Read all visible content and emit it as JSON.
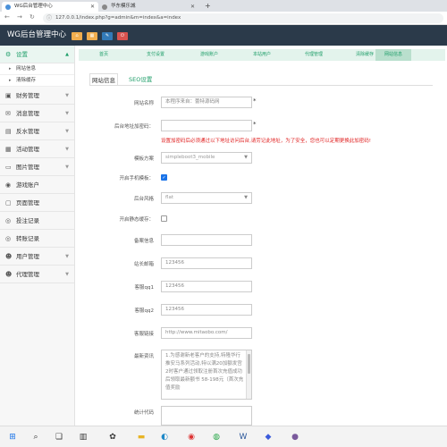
{
  "browser": {
    "tabs": [
      {
        "title": "WG后台管理中心",
        "active": true
      },
      {
        "title": "华东模乐城",
        "active": false
      }
    ],
    "new_tab": "+",
    "url": "127.0.0.1/index.php?g=admin&m=index&a=index"
  },
  "header": {
    "brand": "WG后台管理中心",
    "buttons": [
      {
        "icon": "home-icon",
        "color": "#f0ad4e"
      },
      {
        "icon": "grid-icon",
        "color": "#f0ad4e"
      },
      {
        "icon": "edit-icon",
        "color": "#337ab7"
      },
      {
        "icon": "power-icon",
        "color": "#d9534f"
      }
    ]
  },
  "sidebar": {
    "groups": [
      {
        "label": "设置",
        "icon": "gear-icon",
        "open": true,
        "subitems": [
          "网站信息",
          "清除缓存"
        ]
      },
      {
        "label": "财务管理",
        "icon": "wallet-icon"
      },
      {
        "label": "消息管理",
        "icon": "message-icon"
      },
      {
        "label": "反水管理",
        "icon": "return-icon"
      },
      {
        "label": "活动管理",
        "icon": "calendar-icon"
      },
      {
        "label": "图片管理",
        "icon": "image-icon"
      },
      {
        "label": "游戏账户",
        "icon": "game-icon"
      },
      {
        "label": "页面管理",
        "icon": "page-icon"
      },
      {
        "label": "投注记录",
        "icon": "record-icon"
      },
      {
        "label": "转账记录",
        "icon": "transfer-icon"
      },
      {
        "label": "用户管理",
        "icon": "user-icon"
      },
      {
        "label": "代理管理",
        "icon": "agent-icon"
      }
    ]
  },
  "module_tabs": [
    "首页",
    "支付设置",
    "游戏账户",
    "本站用户",
    "代理管理",
    "清除缓存",
    "网站信息"
  ],
  "module_tab_active": 6,
  "content": {
    "subtabs": [
      "网站信息",
      "SEO设置"
    ],
    "fields": {
      "site_name": {
        "label": "网站名称",
        "placeholder": "本程序来自：蕾特源码网"
      },
      "admin_pwd": {
        "label": "后台地址加密码：",
        "value": ""
      },
      "warning": "设置加密码后必须通过以下地址访问后台,请劳记此地址，为了安全，您也可以定期更换此加密码!",
      "template": {
        "label": "模板方案",
        "value": "simpleboot3_mobile"
      },
      "mobile_template": {
        "label": "开启手机模板：",
        "checked": true
      },
      "admin_style": {
        "label": "后台风格",
        "value": "flat"
      },
      "static_cache": {
        "label": "开启静态缓存：",
        "checked": false
      },
      "icp": {
        "label": "备案信息",
        "value": ""
      },
      "admin_email": {
        "label": "站长邮箱",
        "value": "123456"
      },
      "qq1": {
        "label": "客服qq1",
        "value": "123456"
      },
      "qq2": {
        "label": "客服qq2",
        "value": "123456"
      },
      "service_link": {
        "label": "客服链接",
        "value": "http://www.mitaobo.com/"
      },
      "news": {
        "label": "最新资讯",
        "value": "1.为感谢新老客户的支持,特隆华行推安马系列活动,特以满20加额发宫2时客户通过领取注册首次充值成功后领取最新额书 58-198元（首次充值奖励"
      },
      "stat_code": {
        "label": "统计代码",
        "value": ""
      }
    }
  },
  "taskbar": {
    "icons": [
      "windows-icon",
      "search-icon",
      "task-view-icon",
      "widgets-icon",
      "chat-icon",
      "file-explorer-icon",
      "edge-icon",
      "chrome-icon",
      "wechat-icon",
      "word-icon",
      "app-icon",
      "browser-icon"
    ]
  }
}
